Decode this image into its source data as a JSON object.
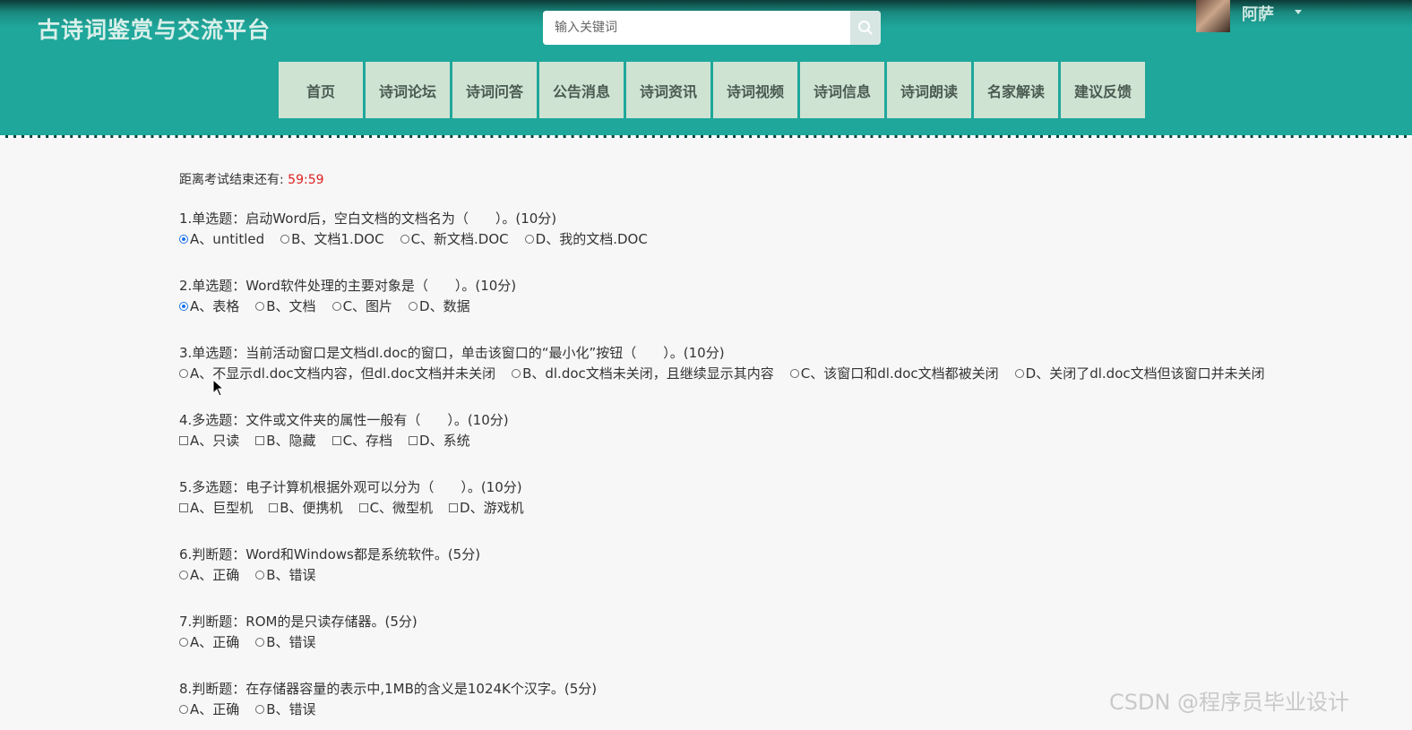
{
  "header": {
    "site_title": "古诗词鉴赏与交流平台",
    "search_placeholder": "输入关键词",
    "username": "阿萨"
  },
  "nav": [
    "首页",
    "诗词论坛",
    "诗词问答",
    "公告消息",
    "诗词资讯",
    "诗词视频",
    "诗词信息",
    "诗词朗读",
    "名家解读",
    "建议反馈"
  ],
  "exam": {
    "timer_label": "距离考试结束还有:",
    "timer_value": "59:59",
    "questions": [
      {
        "text": "1.单选题：启动Word后，空白文档的文档名为（　　）。(10分)",
        "type": "radio",
        "options": [
          {
            "label": "A、untitled",
            "checked": true
          },
          {
            "label": "B、文档1.DOC",
            "checked": false
          },
          {
            "label": "C、新文档.DOC",
            "checked": false
          },
          {
            "label": "D、我的文档.DOC",
            "checked": false
          }
        ]
      },
      {
        "text": "2.单选题：Word软件处理的主要对象是（　　）。(10分)",
        "type": "radio",
        "options": [
          {
            "label": "A、表格",
            "checked": true
          },
          {
            "label": "B、文档",
            "checked": false
          },
          {
            "label": "C、图片",
            "checked": false
          },
          {
            "label": "D、数据",
            "checked": false
          }
        ]
      },
      {
        "text": "3.单选题：当前活动窗口是文档dl.doc的窗口，单击该窗口的“最小化”按钮（　　）。(10分)",
        "type": "radio",
        "options": [
          {
            "label": "A、不显示dl.doc文档内容，但dl.doc文档并未关闭",
            "checked": false
          },
          {
            "label": "B、dl.doc文档未关闭，且继续显示其内容",
            "checked": false
          },
          {
            "label": "C、该窗口和dl.doc文档都被关闭",
            "checked": false
          },
          {
            "label": "D、关闭了dl.doc文档但该窗口并未关闭",
            "checked": false
          }
        ]
      },
      {
        "text": "4.多选题：文件或文件夹的属性一般有（　　）。(10分)",
        "type": "checkbox",
        "options": [
          {
            "label": "A、只读",
            "checked": false
          },
          {
            "label": "B、隐藏",
            "checked": false
          },
          {
            "label": "C、存档",
            "checked": false
          },
          {
            "label": "D、系统",
            "checked": false
          }
        ]
      },
      {
        "text": "5.多选题：电子计算机根据外观可以分为（　　）。(10分)",
        "type": "checkbox",
        "options": [
          {
            "label": "A、巨型机",
            "checked": false
          },
          {
            "label": "B、便携机",
            "checked": false
          },
          {
            "label": "C、微型机",
            "checked": false
          },
          {
            "label": "D、游戏机",
            "checked": false
          }
        ]
      },
      {
        "text": "6.判断题：Word和Windows都是系统软件。(5分)",
        "type": "radio",
        "options": [
          {
            "label": "A、正确",
            "checked": false
          },
          {
            "label": "B、错误",
            "checked": false
          }
        ]
      },
      {
        "text": "7.判断题：ROM的是只读存储器。(5分)",
        "type": "radio",
        "options": [
          {
            "label": "A、正确",
            "checked": false
          },
          {
            "label": "B、错误",
            "checked": false
          }
        ]
      },
      {
        "text": "8.判断题：在存储器容量的表示中,1MB的含义是1024K个汉字。(5分)",
        "type": "radio",
        "options": [
          {
            "label": "A、正确",
            "checked": false
          },
          {
            "label": "B、错误",
            "checked": false
          }
        ]
      }
    ]
  },
  "watermark": "CSDN @程序员毕业设计",
  "colors": {
    "header": "#1fa79b",
    "nav_bg": "#cfe3d3",
    "timer": "#e02020",
    "accent": "#1a73e8"
  }
}
